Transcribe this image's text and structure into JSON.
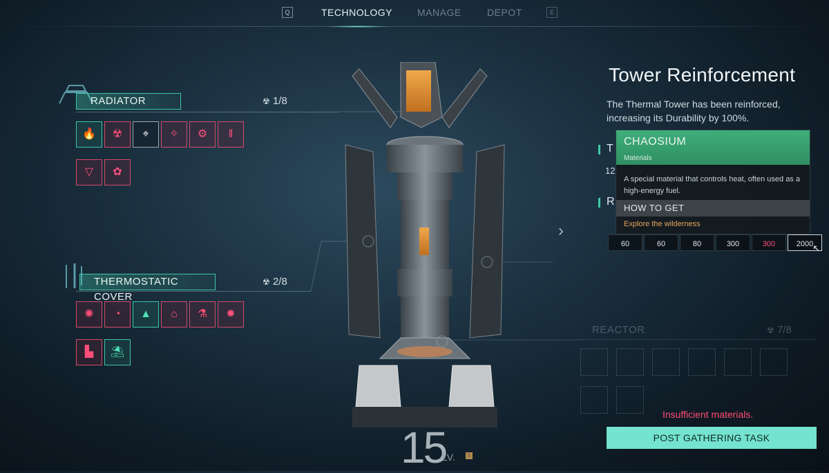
{
  "nav": {
    "left_key": "Q",
    "tabs": [
      "TECHNOLOGY",
      "MANAGE",
      "DEPOT"
    ],
    "right_key": "E",
    "active_tab": "TECHNOLOGY"
  },
  "radiator": {
    "title": "RADIATOR",
    "count": "1/8",
    "icons": [
      {
        "name": "flame-icon",
        "color": "green",
        "glyph": "🔥"
      },
      {
        "name": "radiation-icon",
        "color": "red",
        "glyph": "☢"
      },
      {
        "name": "antenna-icon",
        "color": "white",
        "glyph": "⌖"
      },
      {
        "name": "fan-blade-icon",
        "color": "red",
        "glyph": "✧"
      },
      {
        "name": "gear-icon",
        "color": "red",
        "glyph": "⚙"
      },
      {
        "name": "pipes-icon",
        "color": "red",
        "glyph": "‖"
      },
      {
        "name": "arrow-down-icon",
        "color": "red",
        "glyph": "▽"
      },
      {
        "name": "paw-icon",
        "color": "red",
        "glyph": "✿"
      }
    ]
  },
  "thermostatic_cover": {
    "title": "THERMOSTATIC COVER",
    "count": "2/8",
    "icons": [
      {
        "name": "valve-wheel-icon",
        "color": "red",
        "glyph": "✺"
      },
      {
        "name": "swirl-icon",
        "color": "red",
        "glyph": "◔"
      },
      {
        "name": "pyramid-icon",
        "color": "green",
        "glyph": "▲"
      },
      {
        "name": "shelter-icon",
        "color": "red",
        "glyph": "⌂"
      },
      {
        "name": "flask-icon",
        "color": "red",
        "glyph": "⚗"
      },
      {
        "name": "cog-network-icon",
        "color": "red",
        "glyph": "✹"
      },
      {
        "name": "factory-icon",
        "color": "red",
        "glyph": "▙"
      },
      {
        "name": "beach-umbrella-icon",
        "color": "green",
        "glyph": "⛱"
      }
    ]
  },
  "detail": {
    "title": "Tower Reinforcement",
    "description_line1": "The Thermal Tower has been reinforced,",
    "description_line2": "increasing its Durability by 100%.",
    "time_label_partial": "T",
    "time_value_partial": "12",
    "req_label_partial": "R"
  },
  "tooltip": {
    "name": "CHAOSIUM",
    "category": "Materials",
    "description": "A special material that controls heat, often used as a high-energy fuel.",
    "how_to_get_label": "HOW TO GET",
    "how_to_get_value": "Explore the wilderness"
  },
  "materials": [
    {
      "value": "60",
      "state": "normal"
    },
    {
      "value": "60",
      "state": "normal"
    },
    {
      "value": "80",
      "state": "normal"
    },
    {
      "value": "300",
      "state": "normal"
    },
    {
      "value": "300",
      "state": "insufficient"
    },
    {
      "value": "2000",
      "state": "selected"
    }
  ],
  "reactor": {
    "title": "REACTOR",
    "count": "7/8"
  },
  "status": {
    "message": "Insufficient materials.",
    "button_label": "POST GATHERING TASK"
  },
  "level": {
    "value": "15",
    "label": "LV."
  },
  "colors": {
    "accent_teal": "#3fc7a8",
    "button": "#74e3cf",
    "warning": "#ff4d74",
    "locked_red": "#d54a6a",
    "tooltip_green": "#3fae7a",
    "how_to_get_orange": "#e6a35d"
  }
}
